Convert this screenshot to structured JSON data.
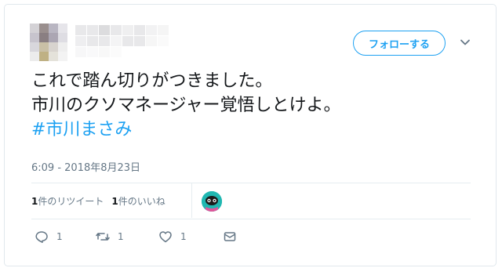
{
  "tweet": {
    "follow_label": "フォローする",
    "text_line1": "これで踏ん切りがつきました。",
    "text_line2": "市川のクソマネージャー覚悟しとけよ。",
    "hashtag": "#市川まさみ",
    "timestamp": "6:09 - 2018年8月23日",
    "retweets_count": "1",
    "retweets_label": "件のリツイート",
    "likes_count": "1",
    "likes_label": "件のいいね",
    "actions": {
      "reply_count": "1",
      "retweet_count": "1",
      "like_count": "1"
    }
  },
  "colors": {
    "accent": "#1da1f2",
    "text": "#14171a",
    "muted": "#657786",
    "border": "#e1e8ed"
  },
  "icons": [
    "caret-down-icon",
    "reply-icon",
    "retweet-icon",
    "heart-icon",
    "dm-icon"
  ]
}
